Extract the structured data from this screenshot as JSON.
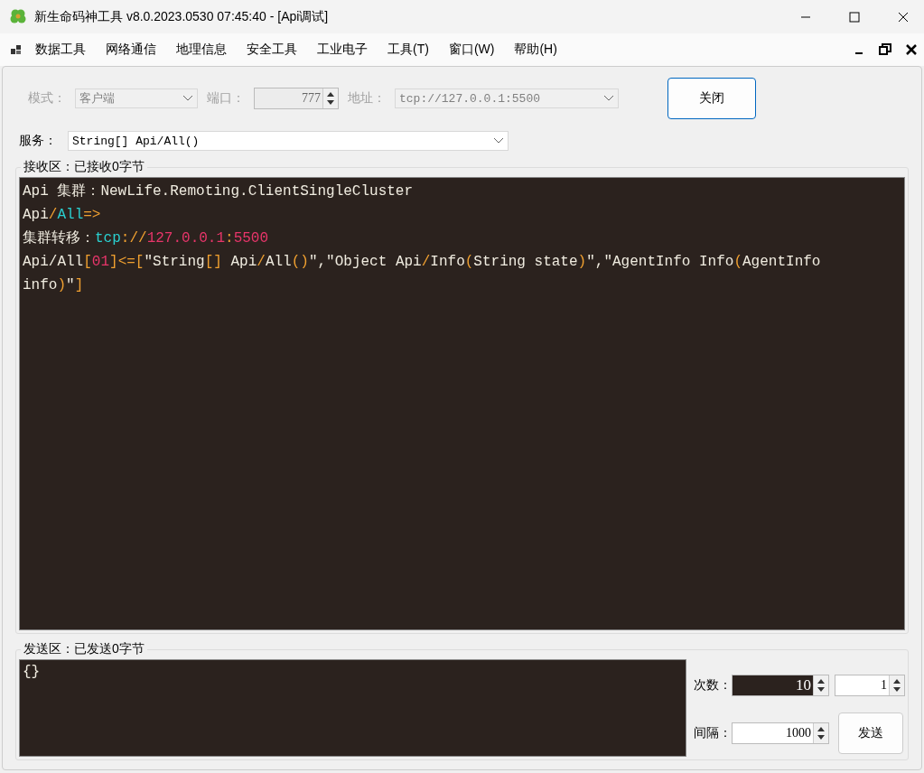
{
  "window": {
    "title": "新生命码神工具 v8.0.2023.0530 07:45:40 - [Api调试]"
  },
  "menu": [
    "数据工具",
    "网络通信",
    "地理信息",
    "安全工具",
    "工业电子",
    "工具(T)",
    "窗口(W)",
    "帮助(H)"
  ],
  "connection": {
    "mode_label": "模式：",
    "mode": "客户端",
    "port_label": "端口：",
    "port": "777",
    "address_label": "地址：",
    "address": "tcp://127.0.0.1:5500",
    "disabled": true,
    "close_button": "关闭"
  },
  "service": {
    "label": "服务：",
    "value": "String[] Api/All()"
  },
  "receive": {
    "title": "接收区：已接收0字节",
    "lines": [
      [
        {
          "text": "Api 集群：NewLife.Remoting.ClientSingleCluster",
          "color": "#f0ece0"
        }
      ],
      [
        {
          "text": "Api",
          "color": "#f0ece0"
        },
        {
          "text": "/",
          "color": "#f0a030"
        },
        {
          "text": "All",
          "color": "#2ad0d0"
        },
        {
          "text": "=>",
          "color": "#f0a030"
        }
      ],
      [
        {
          "text": "集群转移：",
          "color": "#f0ece0"
        },
        {
          "text": "tcp",
          "color": "#2ad0d0"
        },
        {
          "text": "://",
          "color": "#f0a030"
        },
        {
          "text": "127.0.0.1",
          "color": "#e8356a"
        },
        {
          "text": ":",
          "color": "#f0a030"
        },
        {
          "text": "5500",
          "color": "#e8356a"
        }
      ],
      [
        {
          "text": "Api/All",
          "color": "#f0ece0"
        },
        {
          "text": "[",
          "color": "#f0a030"
        },
        {
          "text": "01",
          "color": "#e8356a"
        },
        {
          "text": "]<=[",
          "color": "#f0a030"
        },
        {
          "text": "\"String",
          "color": "#f0ece0"
        },
        {
          "text": "[]",
          "color": "#f0a030"
        },
        {
          "text": " Api",
          "color": "#f0ece0"
        },
        {
          "text": "/",
          "color": "#f0a030"
        },
        {
          "text": "All",
          "color": "#f0ece0"
        },
        {
          "text": "()",
          "color": "#f0a030"
        },
        {
          "text": "\",",
          "color": "#f0ece0"
        },
        {
          "text": "\"Object Api",
          "color": "#f0ece0"
        },
        {
          "text": "/",
          "color": "#f0a030"
        },
        {
          "text": "Info",
          "color": "#f0ece0"
        },
        {
          "text": "(",
          "color": "#f0a030"
        },
        {
          "text": "String state",
          "color": "#f0ece0"
        },
        {
          "text": ")",
          "color": "#f0a030"
        },
        {
          "text": "\",",
          "color": "#f0ece0"
        },
        {
          "text": "\"AgentInfo Info",
          "color": "#f0ece0"
        },
        {
          "text": "(",
          "color": "#f0a030"
        },
        {
          "text": "AgentInfo",
          "color": "#f0ece0"
        }
      ],
      [
        {
          "text": "info",
          "color": "#f0ece0"
        },
        {
          "text": ")",
          "color": "#f0a030"
        },
        {
          "text": "\"",
          "color": "#f0ece0"
        },
        {
          "text": "]",
          "color": "#f0a030"
        }
      ]
    ]
  },
  "send": {
    "title": "发送区：已发送0字节",
    "content": "{}",
    "count_label": "次数：",
    "count": "10",
    "count2": "1",
    "interval_label": "间隔：",
    "interval": "1000",
    "send_button": "发送"
  }
}
